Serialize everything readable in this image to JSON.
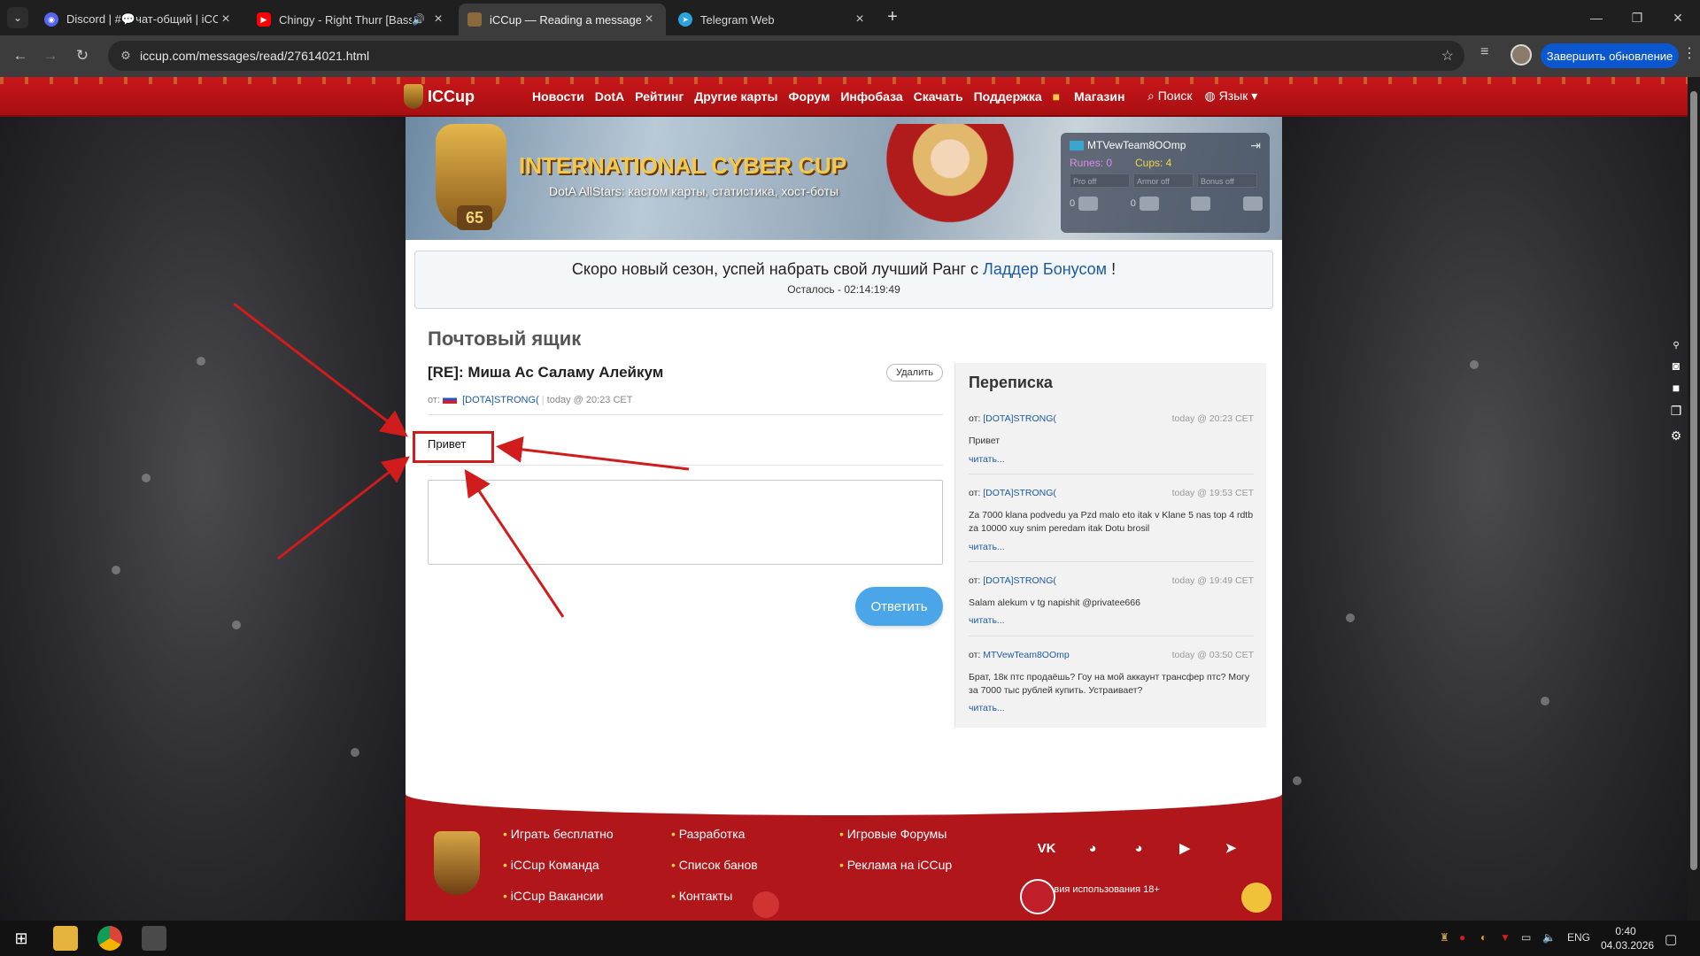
{
  "browser": {
    "tabs": [
      {
        "title": "Discord | #💬чат-общий | iCCup",
        "favicon": "discord-icon",
        "color": "#5865f2"
      },
      {
        "title": "Chingy - Right Thurr [Bass Boosted]",
        "favicon": "youtube-icon",
        "color": "#ff0000",
        "audio": "🔊"
      },
      {
        "title": "iCCup — Reading a message from",
        "favicon": "iccup-icon",
        "color": "#8a6a3a",
        "active": true
      },
      {
        "title": "Telegram Web",
        "favicon": "telegram-icon",
        "color": "#2aa3de"
      }
    ],
    "url": "iccup.com/messages/read/27614021.html",
    "update_button": "Завершить обновление"
  },
  "site": {
    "logo": "ICCup",
    "nav": [
      "Новости",
      "DotA",
      "Рейтинг",
      "Другие карты",
      "Форум",
      "Инфобаза",
      "Скачать",
      "Поддержка",
      "Магазин"
    ],
    "search": "Поиск",
    "language": "Язык"
  },
  "banner": {
    "level": "65",
    "title": "INTERNATIONAL CYBER CUP",
    "subtitle": "DotA AllStars: кастом карты, статистика, хост-боты"
  },
  "user": {
    "name": "MTVewTeam8OOmp",
    "runes_label": "Runes: 0",
    "cups_label": "Cups: 4",
    "bars": [
      "Pro off",
      "Armor off",
      "Bonus off"
    ],
    "messages": "0",
    "warnings": "0"
  },
  "notice": {
    "text": "Скоро новый сезон, успей набрать свой лучший Ранг с",
    "link": "Ладдер Бонусом",
    "suffix": "!",
    "countdown": "Осталось - 02:14:19:49"
  },
  "mailbox": {
    "title": "Почтовый ящик",
    "message": {
      "subject": "[RE]: Миша Ас Саламу Алейкум",
      "delete_label": "Удалить",
      "from_prefix": "от:",
      "from": "[DOTA]STRONG(",
      "time": "today @ 20:23 CET",
      "body": "Привет"
    },
    "reply_label": "Ответить"
  },
  "thread": {
    "title": "Переписка",
    "read_label": "читать...",
    "items": [
      {
        "prefix": "от:",
        "from": "[DOTA]STRONG(",
        "time": "today @ 20:23 CET",
        "text": "Привет"
      },
      {
        "prefix": "от:",
        "from": "[DOTA]STRONG(",
        "time": "today @ 19:53 CET",
        "text": "Za 7000 klana podvedu ya Pzd malo eto itak v Klane 5 nas top 4 rdtb za 10000 xuy snim peredam itak Dotu brosil"
      },
      {
        "prefix": "от:",
        "from": "[DOTA]STRONG(",
        "time": "today @ 19:49 CET",
        "text": "Salam alekum v tg napishit @privatee666"
      },
      {
        "prefix": "от:",
        "from": "MTVewTeam8OOmp",
        "time": "today @ 03:50 CET",
        "text": "Брат, 18к птс продаёшь? Гоу на мой аккаунт трансфер птс? Могу за 7000 тыс рублей купить. Устраивает?"
      }
    ]
  },
  "footer": {
    "col1": [
      "Играть бесплатно",
      "iCCup Команда",
      "iCCup Вакансии"
    ],
    "col2": [
      "Разработка",
      "Список банов",
      "Контакты"
    ],
    "col3": [
      "Игровые Форумы",
      "Реклама на iCCup"
    ],
    "social": [
      "vk-icon",
      "discord-icon",
      "discord-icon",
      "youtube-icon",
      "telegram-icon"
    ],
    "tos": "Условия использования 18+"
  },
  "taskbar": {
    "lang": "ENG",
    "time": "0:40",
    "date": "04.03.2026"
  },
  "colors": {
    "nav_red": "#c8171a",
    "link_blue": "#1c5aa6",
    "reply_blue": "#4aa6e8",
    "annotation_red": "#d01c1c",
    "update_blue": "#0b57d0"
  }
}
